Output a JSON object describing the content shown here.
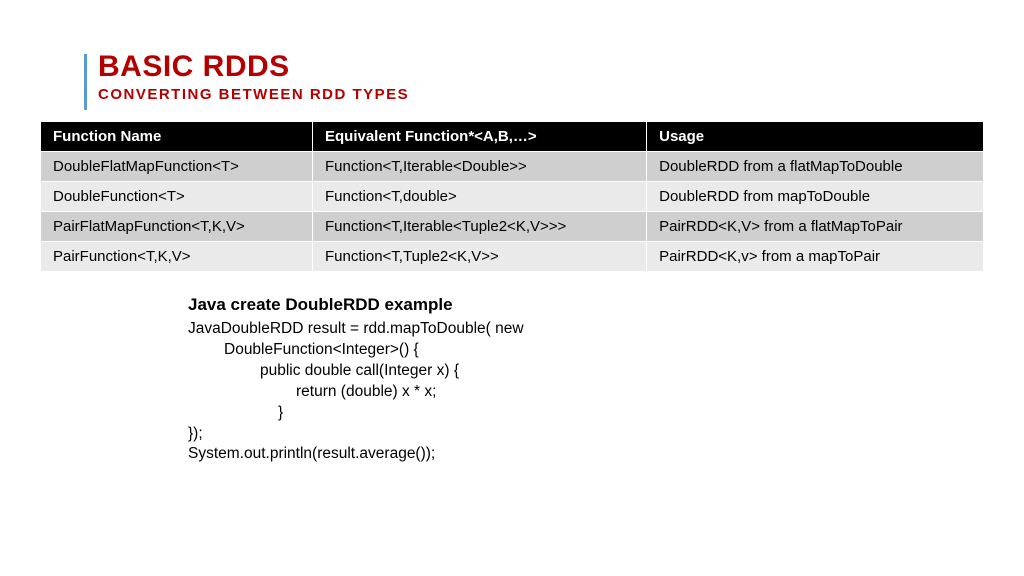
{
  "title": "BASIC RDDS",
  "subtitle": "CONVERTING BETWEEN RDD TYPES",
  "table": {
    "headers": [
      "Function Name",
      "Equivalent Function*<A,B,…>",
      "Usage"
    ],
    "rows": [
      [
        "DoubleFlatMapFunction<T>",
        "Function<T,Iterable<Double>>",
        "DoubleRDD from a flatMapToDouble"
      ],
      [
        "DoubleFunction<T>",
        "Function<T,double>",
        "DoubleRDD from mapToDouble"
      ],
      [
        "PairFlatMapFunction<T,K,V>",
        "Function<T,Iterable<Tuple2<K,V>>>",
        "PairRDD<K,V> from a flatMapToPair"
      ],
      [
        "PairFunction<T,K,V>",
        "Function<T,Tuple2<K,V>>",
        "PairRDD<K,v> from a mapToPair"
      ]
    ]
  },
  "example": {
    "heading": "Java create DoubleRDD example",
    "lines": [
      "JavaDoubleRDD result = rdd.mapToDouble( new",
      "DoubleFunction<Integer>() {",
      "public double call(Integer x) {",
      "return (double) x * x;",
      "}",
      "});",
      "System.out.println(result.average());"
    ]
  }
}
